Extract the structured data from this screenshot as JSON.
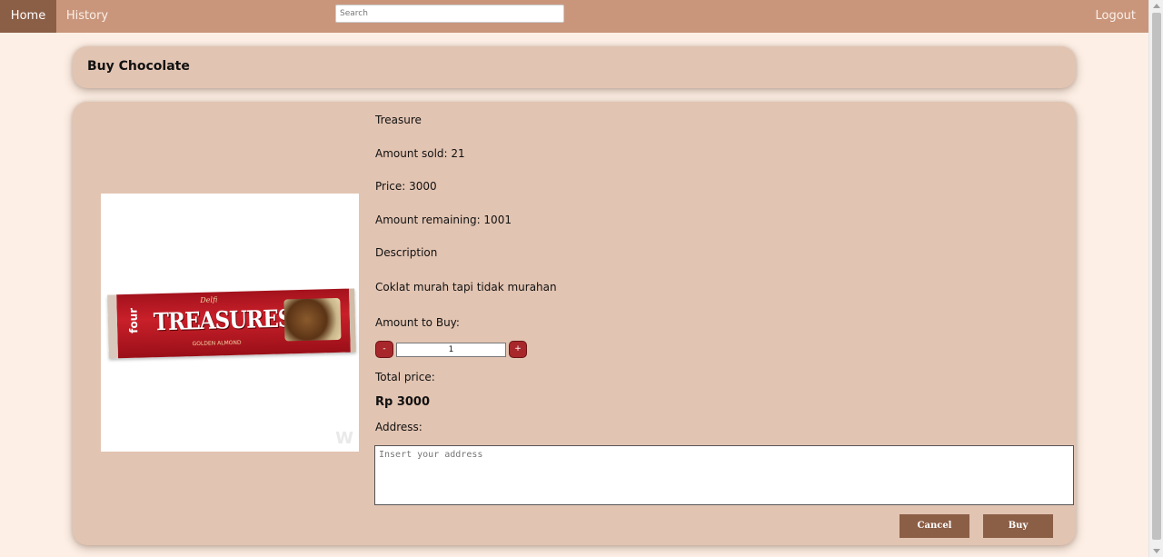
{
  "nav": {
    "home": "Home",
    "history": "History",
    "logout": "Logout",
    "search_placeholder": "Search"
  },
  "header": {
    "title": "Buy Chocolate"
  },
  "product": {
    "image_brand": "Delfi",
    "image_name": "TREASURES",
    "image_variant": "GOLDEN ALMOND",
    "image_pack": "four",
    "name": "Treasure",
    "amount_sold": "Amount sold: 21",
    "price": "Price: 3000",
    "amount_remaining": "Amount remaining: 1001",
    "description_label": "Description",
    "description": "Coklat murah tapi tidak murahan"
  },
  "order": {
    "amount_label": "Amount to Buy:",
    "minus_label": "-",
    "plus_label": "+",
    "quantity": "1",
    "total_label": "Total price:",
    "total_value": "Rp 3000",
    "address_label": "Address:",
    "address_placeholder": "Insert your address"
  },
  "actions": {
    "cancel": "Cancel",
    "buy": "Buy"
  },
  "colors": {
    "navbar": "#c9967c",
    "nav_active": "#8b5e46",
    "card": "#e2c4b2",
    "background": "#fdefe5",
    "stepper": "#a8272b",
    "button": "#8b5e46"
  }
}
